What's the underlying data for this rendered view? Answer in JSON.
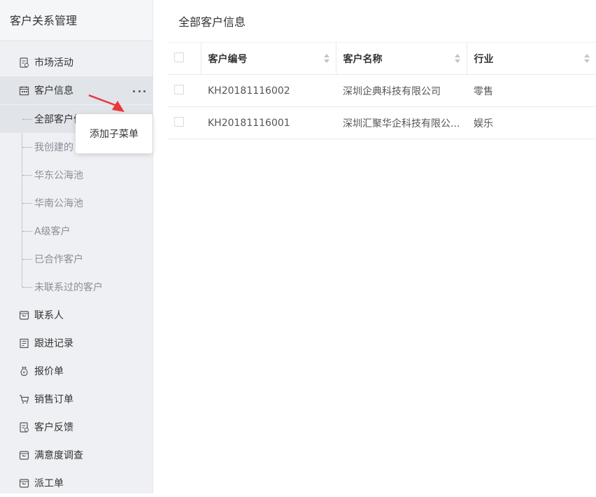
{
  "sidebar": {
    "title": "客户关系管理",
    "items": [
      {
        "label": "市场活动",
        "icon": "document-icon"
      },
      {
        "label": "客户信息",
        "icon": "calendar-icon"
      },
      {
        "label": "联系人",
        "icon": "contact-icon"
      },
      {
        "label": "跟进记录",
        "icon": "record-icon"
      },
      {
        "label": "报价单",
        "icon": "bag-icon"
      },
      {
        "label": "销售订单",
        "icon": "cart-icon"
      },
      {
        "label": "客户反馈",
        "icon": "feedback-icon"
      },
      {
        "label": "满意度调查",
        "icon": "survey-icon"
      },
      {
        "label": "派工单",
        "icon": "dispatch-icon"
      }
    ],
    "subitems": [
      "全部客户信息",
      "我创建的",
      "华东公海池",
      "华南公海池",
      "A级客户",
      "已合作客户",
      "未联系过的客户"
    ],
    "popup_label": "添加子菜单"
  },
  "main": {
    "title": "全部客户信息",
    "columns": [
      "客户编号",
      "客户名称",
      "行业"
    ],
    "rows": [
      {
        "id": "KH20181116002",
        "name": "深圳企典科技有限公司",
        "industry": "零售"
      },
      {
        "id": "KH20181116001",
        "name": "深圳汇聚华企科技有限公...",
        "industry": "娱乐"
      }
    ]
  },
  "colors": {
    "accent": "#e8383d",
    "sidebar_bg": "#eef0f3"
  }
}
